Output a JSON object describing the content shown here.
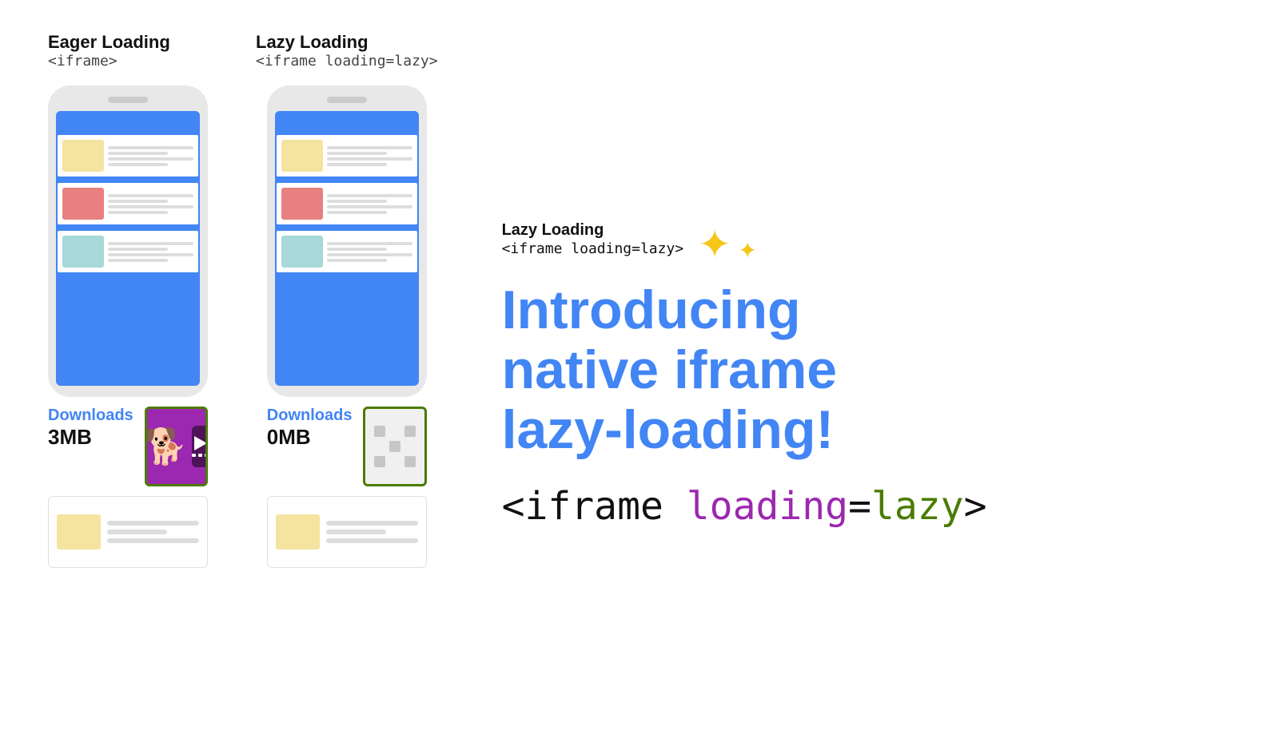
{
  "eager": {
    "title": "Eager Loading",
    "subtitle": "<iframe>",
    "downloads_label": "Downloads",
    "downloads_size": "3MB"
  },
  "lazy": {
    "title": "Lazy Loading",
    "subtitle": "<iframe loading=lazy>",
    "downloads_label": "Downloads",
    "downloads_size": "0MB"
  },
  "right": {
    "intro_line1": "Introducing",
    "intro_line2": "native iframe",
    "intro_line3": "lazy-loading!",
    "code_part1": "<iframe ",
    "code_part2": "loading",
    "code_part3": "=",
    "code_part4": "lazy",
    "code_part5": ">"
  }
}
